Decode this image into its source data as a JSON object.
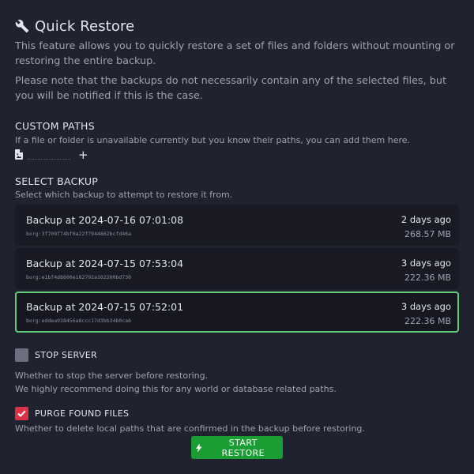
{
  "header": {
    "icon": "wrench-icon",
    "title": "Quick Restore",
    "desc1": "This feature allows you to quickly restore a set of files and folders without mounting or restoring the entire backup.",
    "desc2": "Please note that the backups do not necessarily contain any of the selected files, but you will be notified if this is the case."
  },
  "custom_paths": {
    "title": "CUSTOM PATHS",
    "help": "If a file or folder is unavailable currently but you know their paths, you can add them here.",
    "file_icon": "file-icon",
    "input_value": "",
    "add_icon": "plus-icon",
    "add_label": "+"
  },
  "select_backup": {
    "title": "SELECT BACKUP",
    "help": "Select which backup to attempt to restore it from.",
    "selected_index": 2,
    "selected_color": "#5fce7a",
    "items": [
      {
        "name": "Backup at 2024-07-16 07:01:08",
        "id": "borg:3f709f74bf0a22f7944862bcfd46a",
        "ago": "2 days ago",
        "size": "268.57 MB"
      },
      {
        "name": "Backup at 2024-07-15 07:53:04",
        "id": "borg:e1bf4d8600e182792a102200bd730",
        "ago": "3 days ago",
        "size": "222.36 MB"
      },
      {
        "name": "Backup at 2024-07-15 07:52:01",
        "id": "borg:eddea938456a8ccc17d3bb34b0ca6",
        "ago": "3 days ago",
        "size": "222.36 MB"
      }
    ]
  },
  "stop_server": {
    "label": "STOP SERVER",
    "checked": false,
    "desc1": "Whether to stop the server before restoring.",
    "desc2": "We highly recommend doing this for any world or database related paths."
  },
  "purge": {
    "label": "PURGE FOUND FILES",
    "checked": true,
    "check_color": "#dc3045",
    "desc": "Whether to delete local paths that are confirmed in the backup before restoring."
  },
  "start_button": {
    "icon": "lightning-bolt-icon",
    "label": "START RESTORE",
    "color": "#1a9e33"
  }
}
